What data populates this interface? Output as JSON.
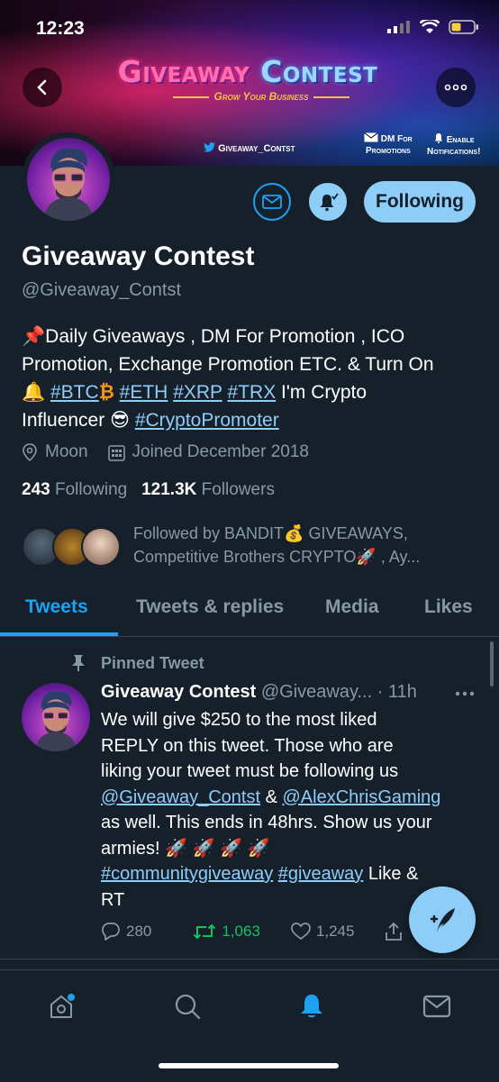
{
  "status_bar": {
    "time": "12:23"
  },
  "banner": {
    "title_part1": "Giveaway",
    "title_part2": "Contest",
    "subtitle": "Grow Your Business",
    "twitter_handle": "Giveaway_Contst",
    "dm_line1": "DM For",
    "dm_line2": "Promotions",
    "notif_line1": "Enable",
    "notif_line2": "Notifications!"
  },
  "profile": {
    "name": "Giveaway Contest",
    "handle": "@Giveaway_Contst",
    "follow_button": "Following",
    "bio": {
      "line1": "📌Daily Giveaways , DM For Promotion , ICO",
      "line2": "Promotion, Exchange Promotion ETC. & Turn On",
      "bell": "🔔",
      "tag_btc": "#BTC",
      "btc_symbol": "₿",
      "tag_eth": "#ETH",
      "tag_xrp": "#XRP",
      "tag_trx": "#TRX",
      "line3_tail": " I'm Crypto",
      "line4_head": "Influencer ",
      "cool_emoji": "😎",
      "tag_promoter": "#CryptoPromoter"
    },
    "location": "Moon",
    "joined": "Joined December 2018",
    "following_count": "243",
    "following_label": "Following",
    "followers_count": "121.3K",
    "followers_label": "Followers",
    "followed_by_line1": "Followed by BANDIT💰 GIVEAWAYS,",
    "followed_by_line2": "Competitive Brothers CRYPTO🚀 , Ay..."
  },
  "tabs": [
    {
      "label": "Tweets",
      "active": true
    },
    {
      "label": "Tweets & replies",
      "active": false
    },
    {
      "label": "Media",
      "active": false
    },
    {
      "label": "Likes",
      "active": false
    }
  ],
  "tweet": {
    "pinned_label": "Pinned Tweet",
    "author_name": "Giveaway Contest",
    "author_handle": "@Giveaway...",
    "time": "· 11h",
    "body_line1": "We will give $250 to the most liked",
    "body_line2": "REPLY on this tweet. Those who are",
    "body_line3": "liking your tweet must be following us",
    "mention1": "@Giveaway_Contst",
    "amp": " & ",
    "mention2": "@AlexChrisGaming",
    "body_line5": "as well. This ends in 48hrs. Show us your",
    "body_line6": "armies! 🚀 🚀 🚀 🚀",
    "tag1": "#communitygiveaway",
    "tag2": "#giveaway",
    "tail": " Like &",
    "tail2": "RT",
    "replies": "280",
    "retweets": "1,063",
    "likes": "1,245"
  },
  "colors": {
    "background": "#15202b",
    "accent": "#1da1f2",
    "accent_light": "#8ecdf8",
    "muted": "#8899a6",
    "retweet_green": "#17bf63"
  },
  "icons": [
    "back-arrow-icon",
    "more-icon",
    "mail-icon",
    "bell-icon",
    "location-icon",
    "calendar-icon",
    "pin-icon",
    "reply-icon",
    "retweet-icon",
    "like-icon",
    "share-icon",
    "compose-icon",
    "home-icon",
    "search-icon",
    "notifications-icon",
    "messages-icon"
  ]
}
